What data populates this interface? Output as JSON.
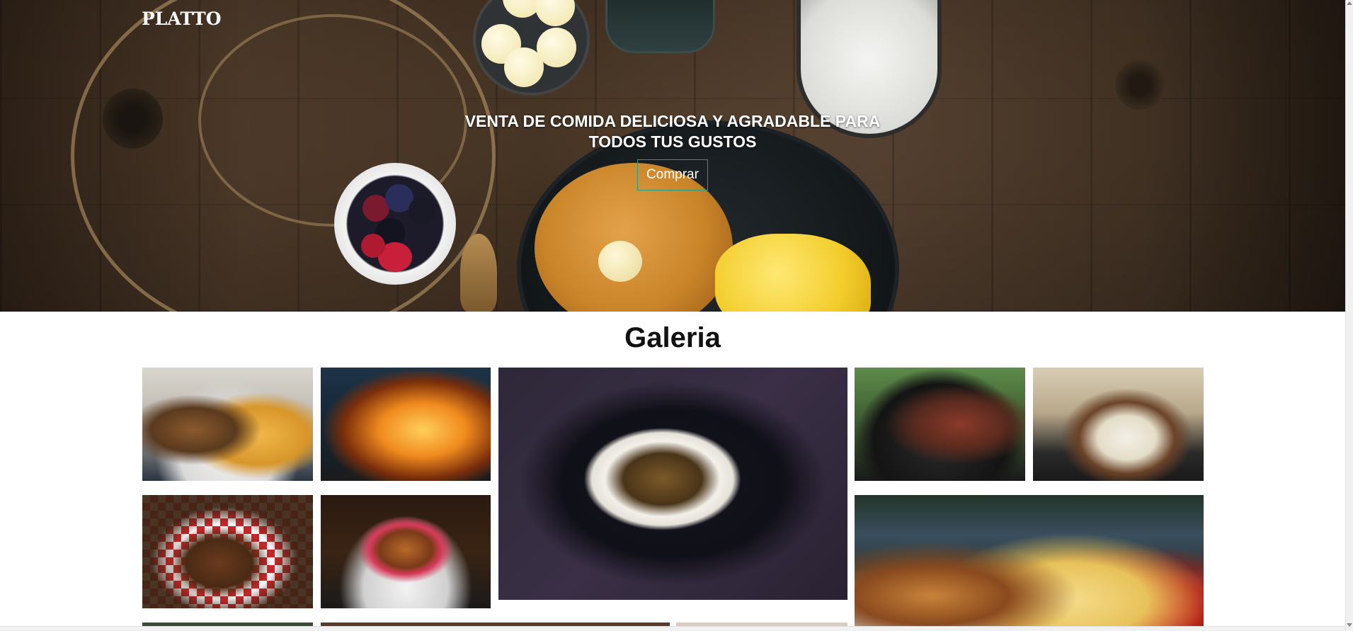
{
  "header": {
    "logo": "PLATTO"
  },
  "hero": {
    "headline_line1": "VENTA DE COMIDA DELICIOSA Y AGRADABLE PARA",
    "headline_line2": "TODOS TUS GUSTOS",
    "button_label": "Comprar",
    "accent_color": "#1e9c84"
  },
  "gallery": {
    "title": "Galeria",
    "images": [
      {
        "name": "hamburguesa-con-papas"
      },
      {
        "name": "parrilla-con-fuego"
      },
      {
        "name": "plato-con-arroz-y-limon"
      },
      {
        "name": "parrilla-con-salchichas"
      },
      {
        "name": "hamburguesas-con-queso"
      },
      {
        "name": "hamburguesa-en-mantel"
      },
      {
        "name": "hamburguesa-gourmet"
      },
      {
        "name": "hamburguesas-y-papas-fritas"
      },
      {
        "name": "imagen-parcial-1"
      },
      {
        "name": "imagen-parcial-2"
      },
      {
        "name": "imagen-parcial-3"
      }
    ]
  }
}
